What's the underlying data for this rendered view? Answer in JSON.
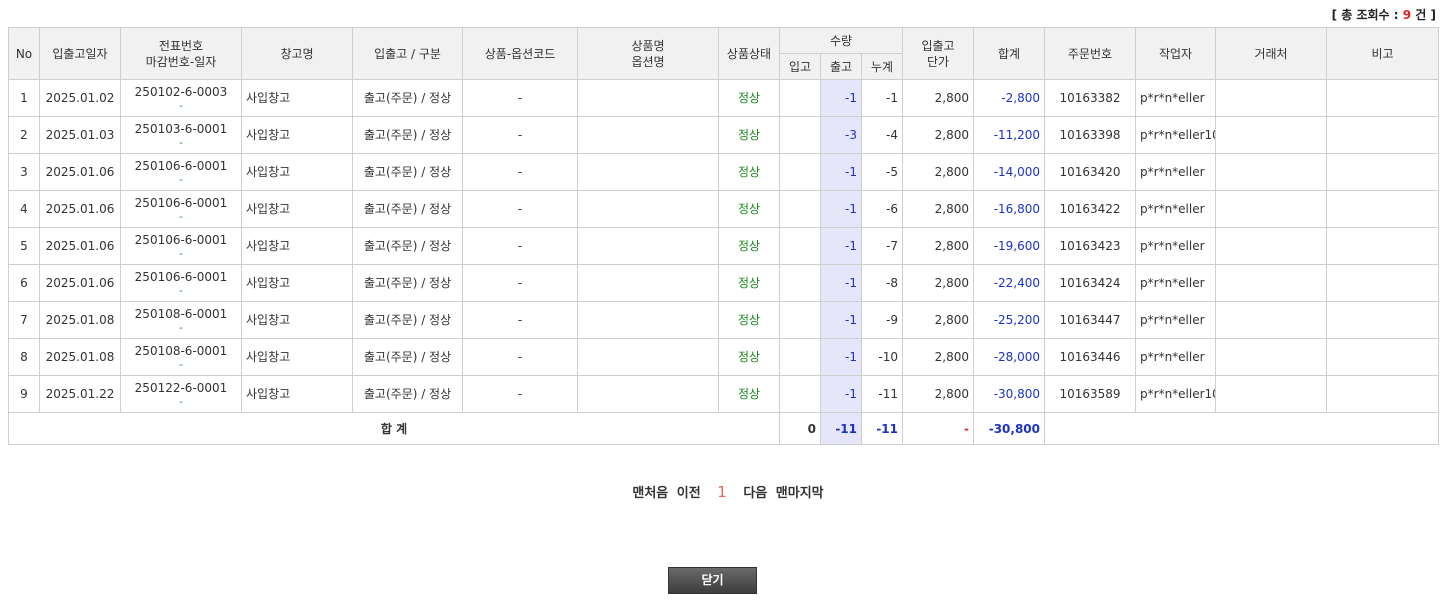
{
  "summary": {
    "prefix": "[ 총 조회수 : ",
    "count": "9",
    "suffix": " 건 ]"
  },
  "headers": {
    "no": "No",
    "date": "입출고일자",
    "slip_line1": "전표번호",
    "slip_line2": "마감번호-일자",
    "warehouse": "창고명",
    "io_type": "입출고 / 구분",
    "option_code": "상품-옵션코드",
    "product_line1": "상품명",
    "product_line2": "옵션명",
    "status": "상품상태",
    "qty": "수량",
    "qty_in": "입고",
    "qty_out": "출고",
    "qty_cum": "누계",
    "unit_line1": "입출고",
    "unit_line2": "단가",
    "total": "합계",
    "order_no": "주문번호",
    "worker": "작업자",
    "partner": "거래처",
    "memo": "비고"
  },
  "rows": [
    {
      "no": "1",
      "date": "2025.01.02",
      "slip": "250102-6-0003",
      "slip_sub": "-",
      "warehouse": "사입창고",
      "io": "출고(주문) / 정상",
      "code": "-",
      "product": "",
      "status": "정상",
      "in": "",
      "out": "-1",
      "cum": "-1",
      "unit": "2,800",
      "total": "-2,800",
      "order": "10163382",
      "worker": "p*r*n*eller",
      "partner": "",
      "memo": ""
    },
    {
      "no": "2",
      "date": "2025.01.03",
      "slip": "250103-6-0001",
      "slip_sub": "-",
      "warehouse": "사입창고",
      "io": "출고(주문) / 정상",
      "code": "-",
      "product": "",
      "status": "정상",
      "in": "",
      "out": "-3",
      "cum": "-4",
      "unit": "2,800",
      "total": "-11,200",
      "order": "10163398",
      "worker": "p*r*n*eller10",
      "partner": "",
      "memo": ""
    },
    {
      "no": "3",
      "date": "2025.01.06",
      "slip": "250106-6-0001",
      "slip_sub": "-",
      "warehouse": "사입창고",
      "io": "출고(주문) / 정상",
      "code": "-",
      "product": "",
      "status": "정상",
      "in": "",
      "out": "-1",
      "cum": "-5",
      "unit": "2,800",
      "total": "-14,000",
      "order": "10163420",
      "worker": "p*r*n*eller",
      "partner": "",
      "memo": ""
    },
    {
      "no": "4",
      "date": "2025.01.06",
      "slip": "250106-6-0001",
      "slip_sub": "-",
      "warehouse": "사입창고",
      "io": "출고(주문) / 정상",
      "code": "-",
      "product": "",
      "status": "정상",
      "in": "",
      "out": "-1",
      "cum": "-6",
      "unit": "2,800",
      "total": "-16,800",
      "order": "10163422",
      "worker": "p*r*n*eller",
      "partner": "",
      "memo": ""
    },
    {
      "no": "5",
      "date": "2025.01.06",
      "slip": "250106-6-0001",
      "slip_sub": "-",
      "warehouse": "사입창고",
      "io": "출고(주문) / 정상",
      "code": "-",
      "product": "",
      "status": "정상",
      "in": "",
      "out": "-1",
      "cum": "-7",
      "unit": "2,800",
      "total": "-19,600",
      "order": "10163423",
      "worker": "p*r*n*eller",
      "partner": "",
      "memo": ""
    },
    {
      "no": "6",
      "date": "2025.01.06",
      "slip": "250106-6-0001",
      "slip_sub": "-",
      "warehouse": "사입창고",
      "io": "출고(주문) / 정상",
      "code": "-",
      "product": "",
      "status": "정상",
      "in": "",
      "out": "-1",
      "cum": "-8",
      "unit": "2,800",
      "total": "-22,400",
      "order": "10163424",
      "worker": "p*r*n*eller",
      "partner": "",
      "memo": ""
    },
    {
      "no": "7",
      "date": "2025.01.08",
      "slip": "250108-6-0001",
      "slip_sub": "-",
      "warehouse": "사입창고",
      "io": "출고(주문) / 정상",
      "code": "-",
      "product": "",
      "status": "정상",
      "in": "",
      "out": "-1",
      "cum": "-9",
      "unit": "2,800",
      "total": "-25,200",
      "order": "10163447",
      "worker": "p*r*n*eller",
      "partner": "",
      "memo": ""
    },
    {
      "no": "8",
      "date": "2025.01.08",
      "slip": "250108-6-0001",
      "slip_sub": "-",
      "warehouse": "사입창고",
      "io": "출고(주문) / 정상",
      "code": "-",
      "product": "",
      "status": "정상",
      "in": "",
      "out": "-1",
      "cum": "-10",
      "unit": "2,800",
      "total": "-28,000",
      "order": "10163446",
      "worker": "p*r*n*eller",
      "partner": "",
      "memo": ""
    },
    {
      "no": "9",
      "date": "2025.01.22",
      "slip": "250122-6-0001",
      "slip_sub": "-",
      "warehouse": "사입창고",
      "io": "출고(주문) / 정상",
      "code": "-",
      "product": "",
      "status": "정상",
      "in": "",
      "out": "-1",
      "cum": "-11",
      "unit": "2,800",
      "total": "-30,800",
      "order": "10163589",
      "worker": "p*r*n*eller10",
      "partner": "",
      "memo": ""
    }
  ],
  "footer": {
    "label": "합 계",
    "in": "0",
    "out": "-11",
    "cum": "-11",
    "unit": "-",
    "total": "-30,800"
  },
  "pager": {
    "first": "맨처음",
    "prev": "이전",
    "current": "1",
    "next": "다음",
    "last": "맨마지막"
  },
  "close_button": "닫기"
}
